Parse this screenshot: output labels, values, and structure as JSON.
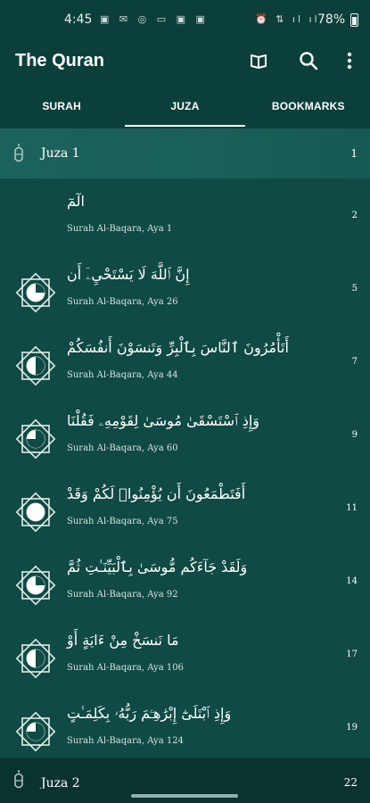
{
  "status_bar": {
    "time": "4:45",
    "left_icons": "▣ ✉ ◎ ▭ ▣ ▣",
    "right_icons": "⏰ ⇅ ıl ıl",
    "battery": "78%"
  },
  "app_bar": {
    "title": "The Quran",
    "icons": [
      "book-icon",
      "search-icon",
      "more-vert-icon"
    ]
  },
  "tabs": [
    {
      "label": "SURAH",
      "active": false
    },
    {
      "label": "JUZA",
      "active": true
    },
    {
      "label": "BOOKMARKS",
      "active": false
    }
  ],
  "juza_headers": [
    {
      "name": "Juza 1",
      "page": "1"
    },
    {
      "name": "Juza 2",
      "page": "22"
    }
  ],
  "rows": [
    {
      "arabic": "الٓمٓ",
      "sub": "Surah Al-Baqara, Aya 1",
      "page": "2",
      "quarter": 0,
      "show_icon": false
    },
    {
      "arabic": "إِنَّ ٱللَّهَ لَا يَسْتَحْيِۦٓ أَن",
      "sub": "Surah Al-Baqara, Aya 26",
      "page": "5",
      "quarter": 1,
      "show_icon": true
    },
    {
      "arabic": "أَتَأْمُرُونَ ٱلنَّاسَ بِٱلْبِرِّ وَتَنسَوْنَ أَنفُسَكُمْ",
      "sub": "Surah Al-Baqara, Aya 44",
      "page": "7",
      "quarter": 2,
      "show_icon": true
    },
    {
      "arabic": "وَإِذِ ٱسْتَسْقَىٰ مُوسَىٰ لِقَوْمِهِۦ فَقُلْنَا",
      "sub": "Surah Al-Baqara, Aya 60",
      "page": "9",
      "quarter": 3,
      "show_icon": true
    },
    {
      "arabic": "أَفَتَطْمَعُونَ أَن يُؤْمِنُوا۟ لَكُمْ وَقَدْ",
      "sub": "Surah Al-Baqara, Aya 75",
      "page": "11",
      "quarter": 0,
      "show_icon": true
    },
    {
      "arabic": "وَلَقَدْ جَآءَكُم مُّوسَىٰ بِٱلْبَيِّنَـٰتِ ثُمَّ",
      "sub": "Surah Al-Baqara, Aya 92",
      "page": "14",
      "quarter": 1,
      "show_icon": true
    },
    {
      "arabic": "مَا نَنسَخْ مِنْ ءَايَةٍ أَوْ",
      "sub": "Surah Al-Baqara, Aya 106",
      "page": "17",
      "quarter": 2,
      "show_icon": true
    },
    {
      "arabic": "وَإِذِ ٱبْتَلَىٰٓ إِبْرَٰهِـۧمَ رَبُّهُۥ بِكَلِمَـٰتٍ",
      "sub": "Surah Al-Baqara, Aya 124",
      "page": "19",
      "quarter": 3,
      "show_icon": true
    }
  ],
  "colors": {
    "background": "#0f4a44",
    "bar": "#0b3f3a",
    "highlight": "#1c625c"
  }
}
